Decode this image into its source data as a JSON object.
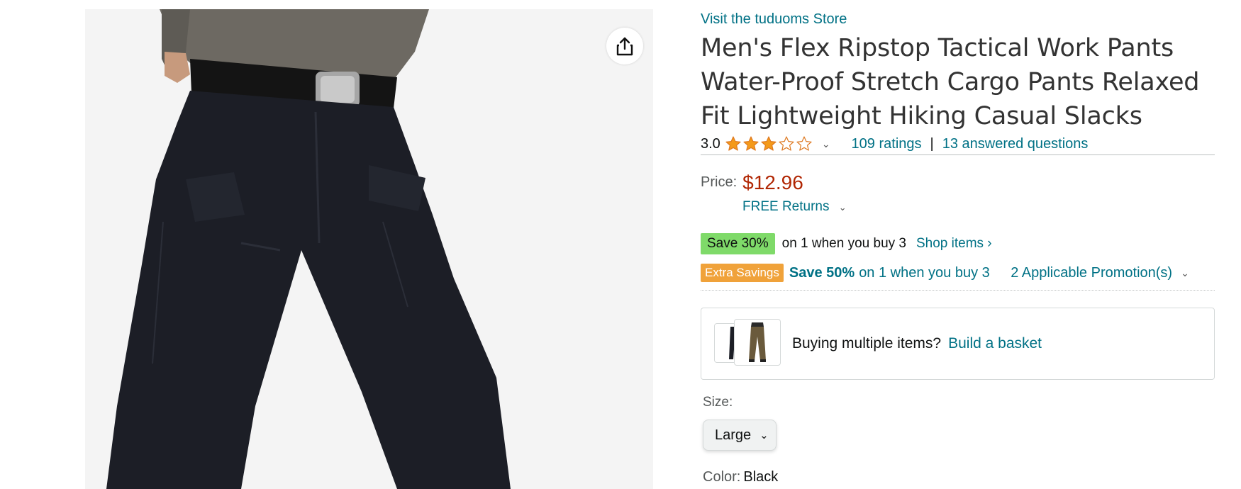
{
  "store": {
    "link_text": "Visit the tuduoms Store"
  },
  "product": {
    "title": "Men's Flex Ripstop Tactical Work Pants Water-Proof Stretch Cargo Pants Relaxed Fit Lightweight Hiking Casual Slacks"
  },
  "rating": {
    "value": "3.0",
    "stars_filled": 3,
    "stars_total": 5,
    "ratings_link": "109 ratings",
    "separator": "|",
    "questions_link": "13 answered questions"
  },
  "price": {
    "label": "Price:",
    "value": "$12.96",
    "returns": "FREE Returns"
  },
  "promos": {
    "save_badge": "Save 30%",
    "save_text": "on 1 when you buy 3",
    "shop_link": "Shop items ›",
    "extra_badge": "Extra Savings",
    "extra_bold": "Save 50%",
    "extra_text": "on 1 when you buy 3",
    "applicable": "2 Applicable Promotion(s)"
  },
  "basket": {
    "question": "Buying multiple items?",
    "link": "Build a basket"
  },
  "size": {
    "label": "Size:",
    "selected": "Large"
  },
  "color": {
    "label": "Color:",
    "value": "Black"
  },
  "icons": {
    "share": "share-icon",
    "star": "star-icon",
    "chevron": "chevron-down-icon"
  },
  "colors": {
    "link": "#007185",
    "price": "#b12704",
    "star": "#f49a1a",
    "save_badge": "#7fda69",
    "extra_badge": "#f0a23a"
  }
}
